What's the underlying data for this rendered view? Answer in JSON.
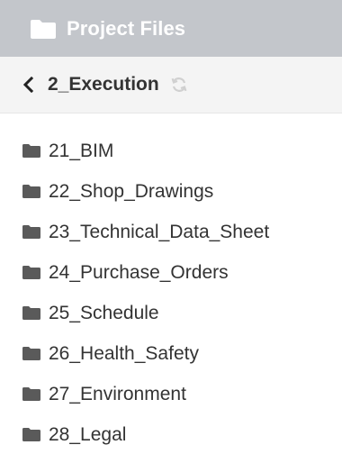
{
  "header": {
    "title": "Project Files",
    "icon": "folder-icon"
  },
  "navbar": {
    "back_icon": "chevron-left-icon",
    "current_folder": "2_Execution",
    "refresh_icon": "refresh-icon"
  },
  "colors": {
    "header_bg": "#c3c6cb",
    "navbar_bg": "#f4f4f4",
    "text": "#333333",
    "folder_icon": "#5a5a5a",
    "refresh_icon": "#d0d0d0"
  },
  "folders": [
    {
      "label": "21_BIM"
    },
    {
      "label": "22_Shop_Drawings"
    },
    {
      "label": "23_Technical_Data_Sheet"
    },
    {
      "label": "24_Purchase_Orders"
    },
    {
      "label": "25_Schedule"
    },
    {
      "label": "26_Health_Safety"
    },
    {
      "label": "27_Environment"
    },
    {
      "label": "28_Legal"
    }
  ]
}
